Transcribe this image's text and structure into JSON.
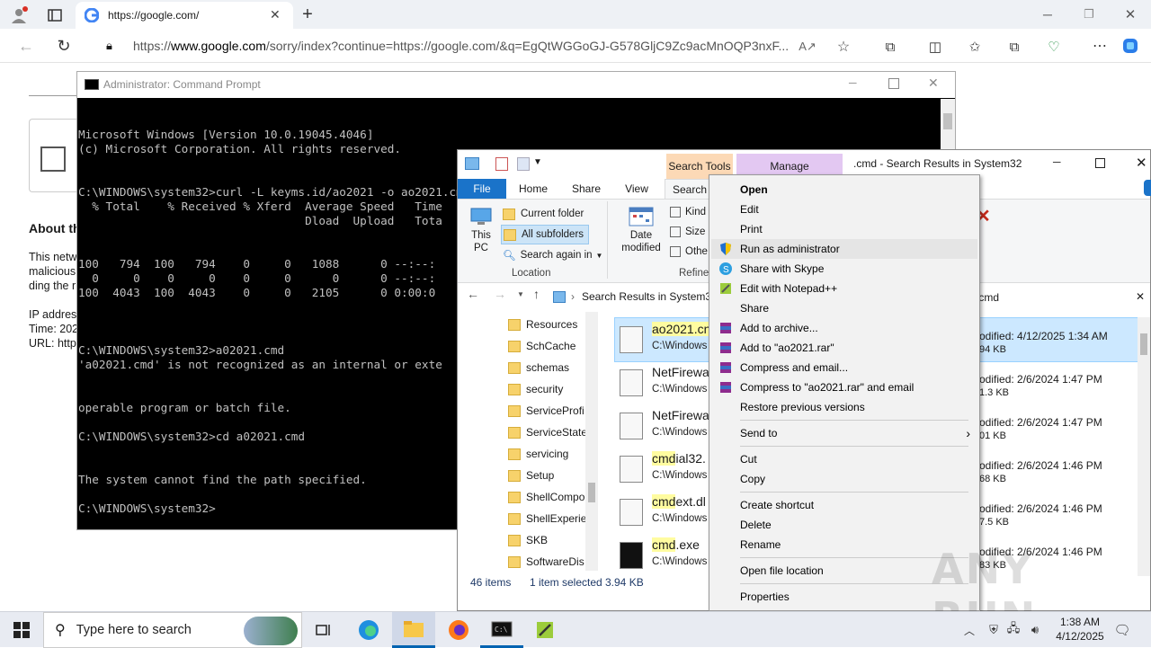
{
  "browser": {
    "tab_title": "https://google.com/",
    "url_prefix": "https://",
    "url_host": "www.google.com",
    "url_rest": "/sorry/index?continue=https://google.com/&q=EgQtWGGoGJ-G578GljC9Zc9acMnOQP3nxF..."
  },
  "page": {
    "about_heading": "About th",
    "lines": [
      "This netw",
      "malicious",
      "ding the r",
      "IP addres",
      "Time: 202",
      "URL: http"
    ]
  },
  "cmd": {
    "title": "Administrator: Command Prompt",
    "lines": [
      "Microsoft Windows [Version 10.0.19045.4046]",
      "(c) Microsoft Corporation. All rights reserved.",
      "",
      "C:\\WINDOWS\\system32>curl -L keyms.id/ao2021 -o ao2021.cmd",
      "  % Total    % Received % Xferd  Average Speed   Time",
      "                                 Dload  Upload   Tota",
      "100   794  100   794    0     0   1088      0 --:--:",
      "  0     0    0     0    0     0      0      0 --:--:",
      "100  4043  100  4043    0     0   2105      0 0:00:0",
      "",
      "C:\\WINDOWS\\system32>a02021.cmd",
      "'a02021.cmd' is not recognized as an internal or exte",
      "operable program or batch file.",
      "",
      "C:\\WINDOWS\\system32>cd a02021.cmd",
      "The system cannot find the path specified.",
      "",
      "C:\\WINDOWS\\system32>"
    ]
  },
  "explorer": {
    "title": ".cmd - Search Results in System32",
    "search_tools": "Search Tools",
    "manage": "Manage",
    "tabs": [
      "File",
      "Home",
      "Share",
      "View",
      "Search"
    ],
    "ribbon": {
      "this_pc": "This PC",
      "current_folder": "Current folder",
      "all_subfolders": "All subfolders",
      "search_again": "Search again in",
      "location": "Location",
      "date_modified": "Date modified",
      "kind": "Kind",
      "size": "Size",
      "other": "Othe",
      "refine": "Refine"
    },
    "breadcrumb": "Search Results in System32",
    "search_value": ".cmd",
    "tree": [
      "Resources",
      "SchCache",
      "schemas",
      "security",
      "ServiceProfi",
      "ServiceState",
      "servicing",
      "Setup",
      "ShellCompo",
      "ShellExperie",
      "SKB",
      "SoftwareDis"
    ],
    "files": [
      {
        "pre": "",
        "hl": "ao2021.cn",
        "post": "",
        "path": "C:\\Windows",
        "modified": "odified: 4/12/2025 1:34 AM",
        "size": "94 KB"
      },
      {
        "pre": "NetFirewa",
        "hl": "",
        "post": "",
        "path": "C:\\Windows",
        "modified": "odified: 2/6/2024 1:47 PM",
        "size": "1.3 KB"
      },
      {
        "pre": "NetFirewa",
        "hl": "",
        "post": "",
        "path": "C:\\Windows",
        "modified": "odified: 2/6/2024 1:47 PM",
        "size": "01 KB"
      },
      {
        "pre": "",
        "hl": "cmd",
        "post": "ial32.",
        "path": "C:\\Windows",
        "modified": "odified: 2/6/2024 1:46 PM",
        "size": "68 KB"
      },
      {
        "pre": "",
        "hl": "cmd",
        "post": "ext.dl",
        "path": "C:\\Windows",
        "modified": "odified: 2/6/2024 1:46 PM",
        "size": "7.5 KB"
      },
      {
        "pre": "",
        "hl": "cmd",
        "post": ".exe",
        "path": "C:\\Windows",
        "modified": "odified: 2/6/2024 1:46 PM",
        "size": "83 KB"
      }
    ],
    "status": {
      "count": "46 items",
      "selected": "1 item selected",
      "size": "3.94 KB"
    }
  },
  "context_menu": {
    "items": [
      "Open",
      "Edit",
      "Print",
      "Run as administrator",
      "Share with Skype",
      "Edit with Notepad++",
      "Share",
      "Add to archive...",
      "Add to \"ao2021.rar\"",
      "Compress and email...",
      "Compress to \"ao2021.rar\" and email",
      "Restore previous versions",
      "Send to",
      "Cut",
      "Copy",
      "Create shortcut",
      "Delete",
      "Rename",
      "Open file location",
      "Properties"
    ]
  },
  "taskbar": {
    "search_placeholder": "Type here to search",
    "time": "1:38 AM",
    "date": "4/12/2025"
  },
  "watermark": "ANY RUN",
  "colors": {
    "accent": "#0063b1",
    "highlight": "#fffca0",
    "cmd_bg": "#000000"
  }
}
